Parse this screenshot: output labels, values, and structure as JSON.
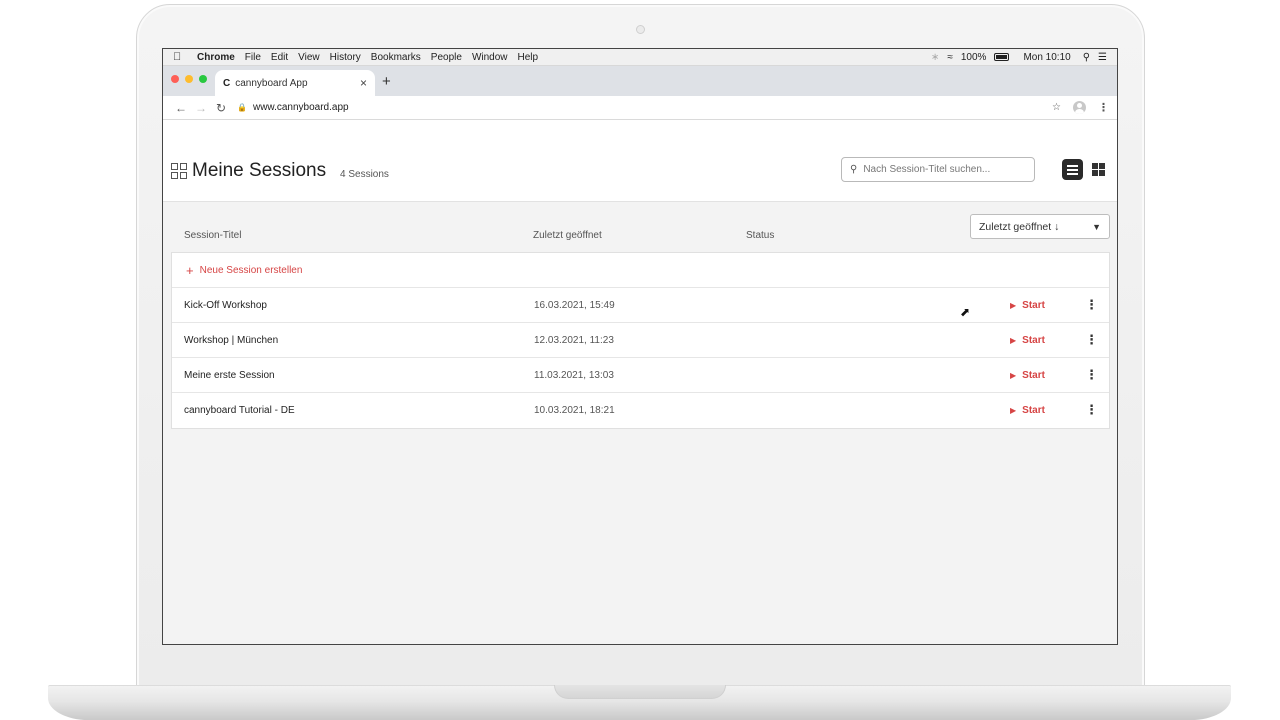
{
  "menubar": {
    "app": "Chrome",
    "items": [
      "File",
      "Edit",
      "View",
      "History",
      "Bookmarks",
      "People",
      "Window",
      "Help"
    ],
    "battery": "100%",
    "clock": "Mon 10:10"
  },
  "browser": {
    "tab_title": "cannyboard App",
    "tab_favicon": "C",
    "url": "www.cannyboard.app"
  },
  "page": {
    "title": "Meine Sessions",
    "count": "4 Sessions",
    "search_placeholder": "Nach Session-Titel suchen..."
  },
  "table": {
    "columns": [
      "Session-Titel",
      "Zuletzt geöffnet",
      "Status"
    ],
    "sort_label": "Zuletzt geöffnet ↓",
    "new_session_label": "Neue Session erstellen",
    "start_label": "Start",
    "rows": [
      {
        "title": "Kick-Off Workshop",
        "date": "16.03.2021, 15:49"
      },
      {
        "title": "Workshop | München",
        "date": "12.03.2021, 11:23"
      },
      {
        "title": "Meine erste Session",
        "date": "11.03.2021, 13:03"
      },
      {
        "title": "cannyboard Tutorial - DE",
        "date": "10.03.2021, 18:21"
      }
    ]
  },
  "colors": {
    "accent": "#d64545",
    "background": "#f3f3f3"
  }
}
